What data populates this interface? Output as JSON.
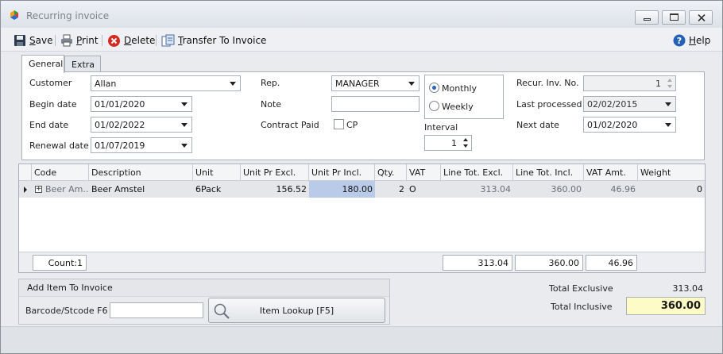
{
  "window": {
    "title": "Recurring invoice"
  },
  "toolbar": {
    "save": {
      "key": "S",
      "rest": "ave"
    },
    "print": {
      "key": "P",
      "rest": "rint"
    },
    "delete": {
      "key": "D",
      "rest": "elete"
    },
    "transfer": {
      "key": "T",
      "rest": "ransfer To Invoice"
    },
    "help": {
      "key": "H",
      "rest": "elp"
    }
  },
  "tabs": {
    "general": "General",
    "extra": "Extra"
  },
  "form": {
    "customer_label": "Customer",
    "customer_value": "Allan",
    "begin_label": "Begin date",
    "begin_value": "01/01/2020",
    "end_label": "End date",
    "end_value": "01/02/2022",
    "renewal_label": "Renewal date",
    "renewal_value": "01/07/2019",
    "rep_label": "Rep.",
    "rep_value": "MANAGER",
    "note_label": "Note",
    "note_value": "",
    "contract_label": "Contract Paid",
    "cp_label": "CP",
    "monthly_label": "Monthly",
    "weekly_label": "Weekly",
    "interval_label": "Interval",
    "interval_value": "1",
    "recur_label": "Recur. Inv. No.",
    "recur_value": "1",
    "last_label": "Last processed",
    "last_value": "02/02/2015",
    "next_label": "Next date",
    "next_value": "01/02/2020"
  },
  "grid": {
    "columns": {
      "code": "Code",
      "description": "Description",
      "unit": "Unit",
      "unit_excl": "Unit Pr Excl.",
      "unit_incl": "Unit Pr Incl.",
      "qty": "Qty.",
      "vat": "VAT",
      "line_excl": "Line Tot. Excl.",
      "line_incl": "Line Tot. Incl.",
      "vat_amt": "VAT Amt.",
      "weight": "Weight"
    },
    "row": {
      "code": "Beer Am...",
      "description": "Beer Amstel",
      "unit": "6Pack",
      "unit_excl": "156.52",
      "unit_incl": "180.00",
      "qty": "2",
      "vat": "O",
      "line_excl": "313.04",
      "line_incl": "360.00",
      "vat_amt": "46.96",
      "weight": "0"
    },
    "footer": {
      "count": "Count:1",
      "line_excl": "313.04",
      "line_incl": "360.00",
      "vat_amt": "46.96"
    }
  },
  "add_item": {
    "title": "Add Item To Invoice",
    "barcode_label": "Barcode/Stcode F6",
    "barcode_value": "",
    "lookup_label": "Item Lookup [F5]"
  },
  "totals": {
    "exclusive_label": "Total Exclusive",
    "exclusive_value": "313.04",
    "inclusive_label": "Total Inclusive",
    "inclusive_value": "360.00"
  },
  "colors": {
    "accent": "#2b63b7",
    "highlight_cell": "#b9cbe9",
    "total_box": "#fdfbc6"
  }
}
